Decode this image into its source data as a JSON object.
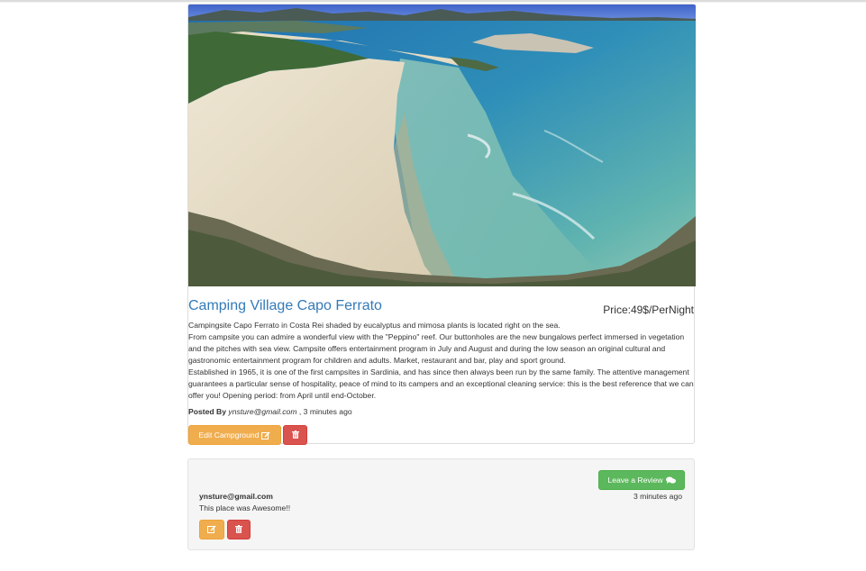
{
  "campground": {
    "title": "Camping Village Capo Ferrato",
    "price": "Price:49$/PerNight",
    "description": [
      "Campingsite Capo Ferrato in Costa Rei shaded by eucalyptus and mimosa plants is located right on the sea.",
      "From campsite you can admire a wonderful view with the \"Peppino\" reef. Our buttonholes are the new bungalows perfect immersed in vegetation and the pitches with sea view. Campsite offers entertainment program in July and August and during the low season an original cultural and gastronomic entertainment program for children and adults. Market, restaurant and bar, play and sport ground.",
      "Established in 1965, it is one of the first campsites in Sardinia, and has since then always been run by the same family. The attentive management guarantees a particular sense of hospitality, peace of mind to its campers and an exceptional cleaning service: this is the best reference that we can offer you! Opening period: from April until end-October."
    ],
    "posted_by_label": "Posted By",
    "author": "ynsture@gmail.com",
    "time_separator": ", 3 minutes ago",
    "edit_label": "Edit Campground",
    "edit_icon": "edit-icon",
    "delete_icon": "trash-icon"
  },
  "reviews": {
    "leave_review_label": "Leave a Review",
    "leave_review_icon": "comments-icon",
    "items": [
      {
        "author": "ynsture@gmail.com",
        "time": "3 minutes ago",
        "text": "This place was Awesome!!",
        "edit_icon": "edit-icon",
        "delete_icon": "trash-icon"
      }
    ]
  },
  "colors": {
    "link": "#337ab7",
    "warning": "#f0ad4e",
    "danger": "#d9534f",
    "success": "#5cb85c"
  }
}
